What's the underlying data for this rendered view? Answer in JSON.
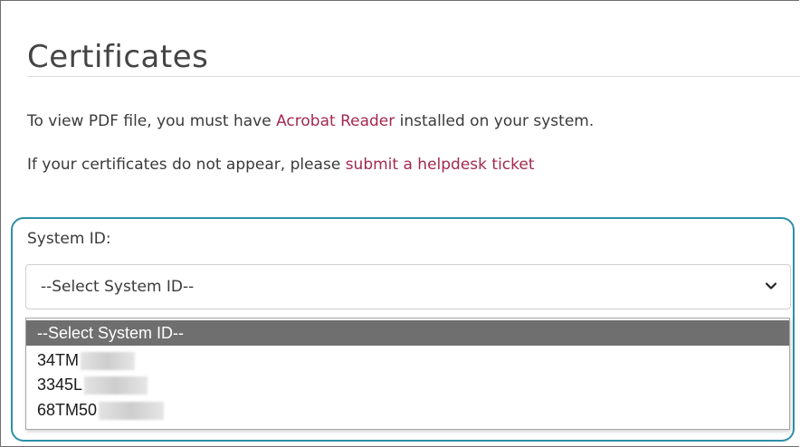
{
  "page": {
    "title": "Certificates",
    "info_prefix": "To view PDF file, you must have ",
    "acrobat_link": "Acrobat Reader",
    "info_suffix": " installed on your system.",
    "helpdesk_prefix": "If your certificates do not appear, please ",
    "helpdesk_link": "submit a helpdesk ticket"
  },
  "form": {
    "system_id_label": "System ID:",
    "selected_value": "--Select System ID--",
    "options": [
      "--Select System ID--",
      "34TM",
      "3345L",
      "68TM50"
    ]
  },
  "colors": {
    "link": "#a3294f",
    "highlight_border": "#2d90a8",
    "selected_option_bg": "#6f6f6f"
  },
  "icons": {
    "dropdown": "chevron-down-icon"
  }
}
